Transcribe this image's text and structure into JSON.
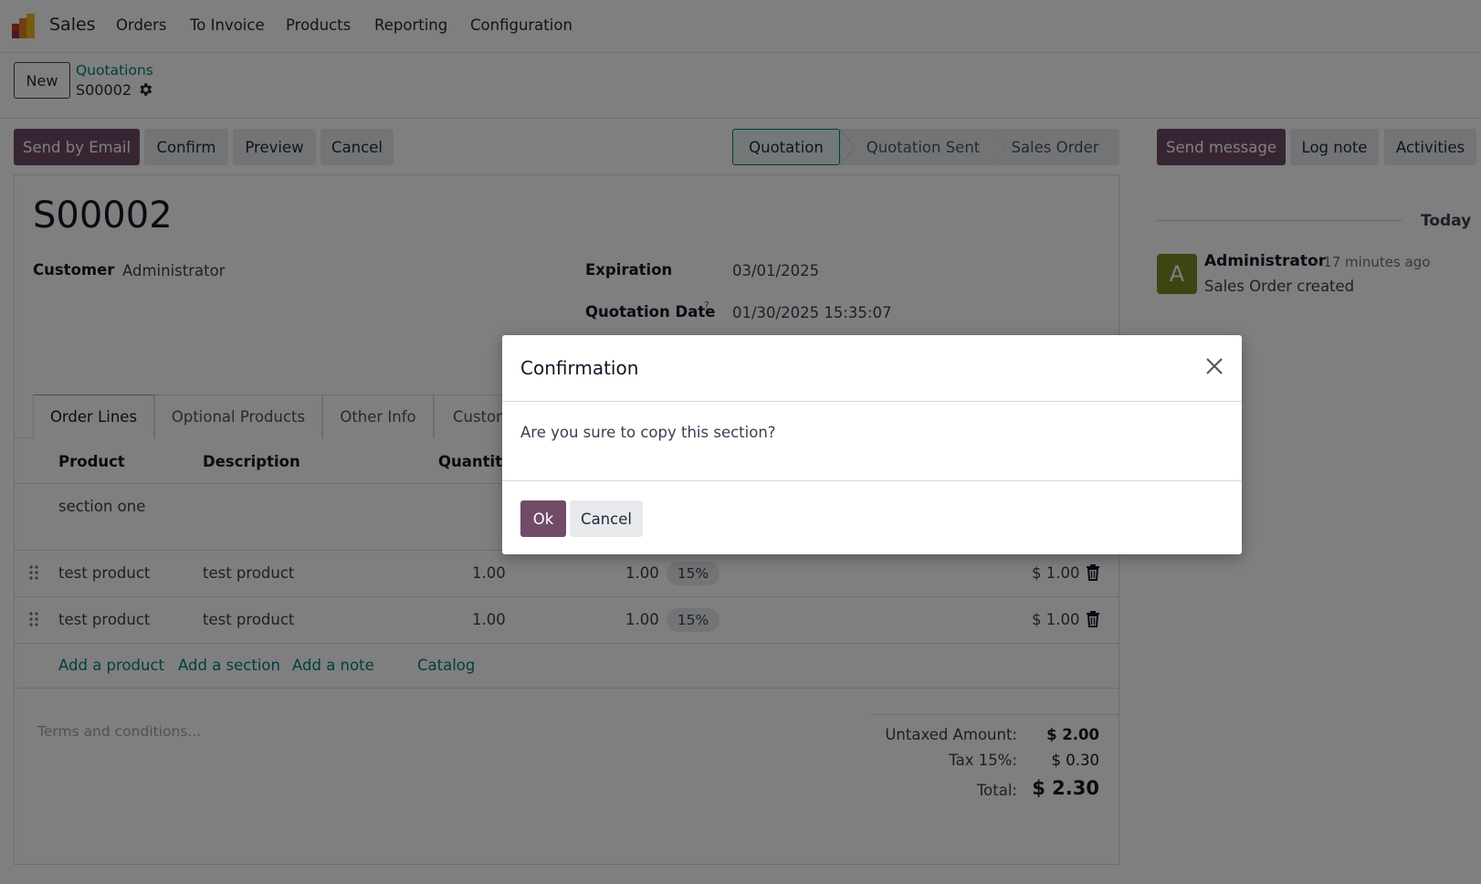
{
  "navbar": {
    "app_name": "Sales",
    "menu": [
      "Orders",
      "To Invoice",
      "Products",
      "Reporting",
      "Configuration"
    ]
  },
  "control_panel": {
    "new_label": "New",
    "breadcrumb_parent": "Quotations",
    "breadcrumb_current": "S00002"
  },
  "actions": {
    "send_email": "Send by Email",
    "confirm": "Confirm",
    "preview": "Preview",
    "cancel": "Cancel"
  },
  "status_stages": [
    "Quotation",
    "Quotation Sent",
    "Sales Order"
  ],
  "active_stage": "Quotation",
  "form": {
    "title": "S00002",
    "customer_label": "Customer",
    "customer_value": "Administrator",
    "expiration_label": "Expiration",
    "expiration_value": "03/01/2025",
    "quotation_date_label": "Quotation Date",
    "quotation_date_help": "?",
    "quotation_date_value": "01/30/2025 15:35:07"
  },
  "tabs": [
    "Order Lines",
    "Optional Products",
    "Other Info",
    "Custom"
  ],
  "table": {
    "headers": [
      "Product",
      "Description",
      "Quantity"
    ],
    "section_row": "section one",
    "rows": [
      {
        "product": "test product",
        "description": "test product",
        "quantity": "1.00",
        "unit_price": "1.00",
        "tax": "15%",
        "amount": "$ 1.00"
      },
      {
        "product": "test product",
        "description": "test product",
        "quantity": "1.00",
        "unit_price": "1.00",
        "tax": "15%",
        "amount": "$ 1.00"
      }
    ],
    "add_links": [
      "Add a product",
      "Add a section",
      "Add a note",
      "Catalog"
    ]
  },
  "terms_placeholder": "Terms and conditions...",
  "totals": {
    "untaxed_label": "Untaxed Amount:",
    "untaxed_value": "$ 2.00",
    "tax_label": "Tax 15%:",
    "tax_value": "$ 0.30",
    "total_label": "Total:",
    "total_value": "$ 2.30"
  },
  "chatter": {
    "send_message": "Send message",
    "log_note": "Log note",
    "activities": "Activities",
    "date_separator": "Today",
    "message": {
      "avatar_letter": "A",
      "author": "Administrator",
      "time": "- 17 minutes ago",
      "body": "Sales Order created"
    }
  },
  "modal": {
    "title": "Confirmation",
    "body": "Are you sure to copy this section?",
    "ok_label": "Ok",
    "cancel_label": "Cancel"
  },
  "colors": {
    "primary": "#714b67",
    "link": "#017e84",
    "avatar_bg": "#7a8a26"
  }
}
